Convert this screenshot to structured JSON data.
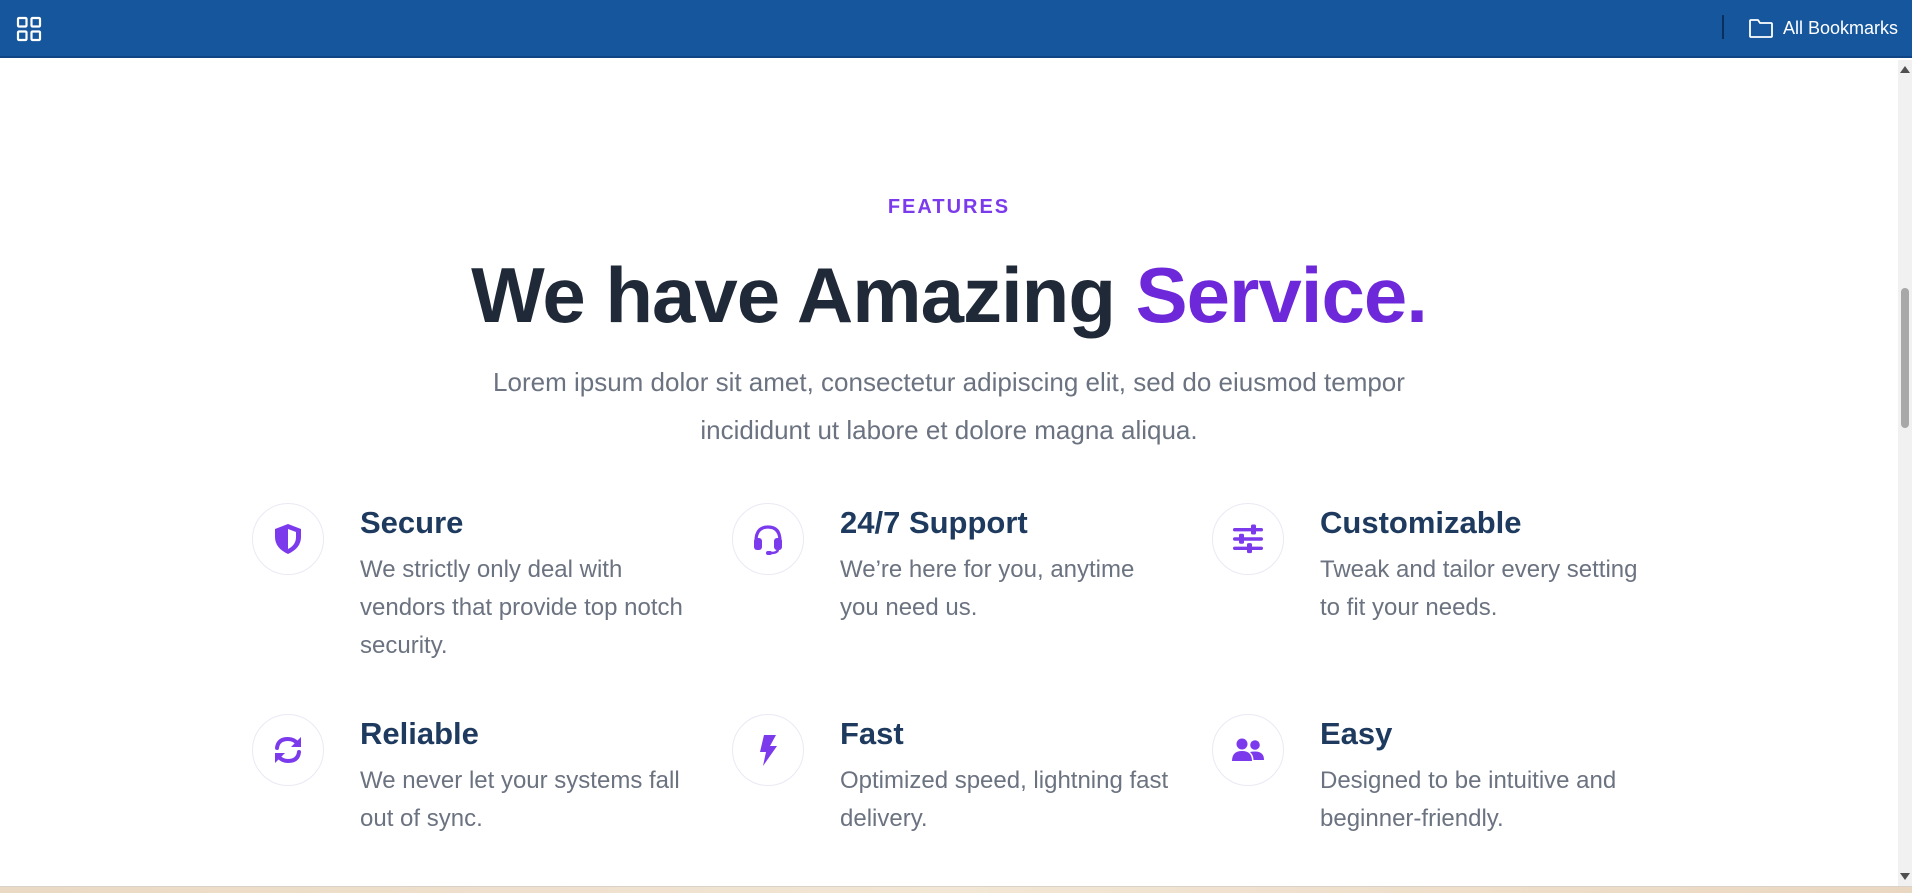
{
  "toolbar": {
    "apps_icon": "apps-grid-icon",
    "bookmarks_icon": "folder-icon",
    "bookmarks_label": "All Bookmarks"
  },
  "features_section": {
    "eyebrow": "FEATURES",
    "headline_main": "We have Amazing ",
    "headline_accent": "Service",
    "headline_period": ".",
    "lead": "Lorem ipsum dolor sit amet, consectetur adipiscing elit, sed do eiusmod tempor incididunt ut labore et dolore magna aliqua.",
    "accent_color": "#6d28d9",
    "items": [
      {
        "icon": "shield-icon",
        "title": "Secure",
        "description": "We strictly only deal with vendors that provide top notch security."
      },
      {
        "icon": "headset-icon",
        "title": "24/7 Support",
        "description": "We’re here for you, anytime you need us."
      },
      {
        "icon": "sliders-icon",
        "title": "Customizable",
        "description": "Tweak and tailor every setting to fit your needs."
      },
      {
        "icon": "sync-icon",
        "title": "Reliable",
        "description": "We never let your systems fall out of sync."
      },
      {
        "icon": "lightning-bolt-icon",
        "title": "Fast",
        "description": "Optimized speed, lightning fast delivery."
      },
      {
        "icon": "users-icon",
        "title": "Easy",
        "description": "Designed to be intuitive and beginner-friendly."
      }
    ]
  }
}
